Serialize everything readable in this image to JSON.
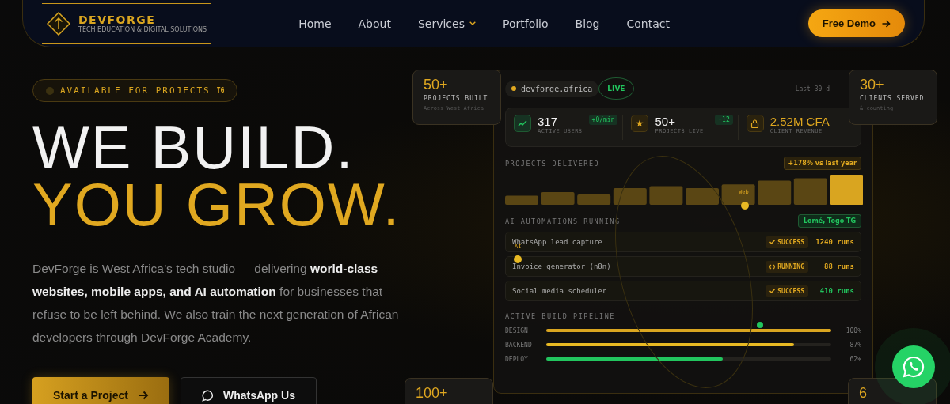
{
  "nav": {
    "logo": {
      "name": "DEVFORGE",
      "tagline": "TECH EDUCATION & DIGITAL SOLUTIONS"
    },
    "links": [
      {
        "label": "Home",
        "dropdown": false
      },
      {
        "label": "About",
        "dropdown": false
      },
      {
        "label": "Services",
        "dropdown": true
      },
      {
        "label": "Portfolio",
        "dropdown": false
      },
      {
        "label": "Blog",
        "dropdown": false
      },
      {
        "label": "Contact",
        "dropdown": false
      }
    ],
    "cta": "Free Demo"
  },
  "hero": {
    "badge": {
      "text": "AVAILABLE FOR PROJECTS",
      "flag": "TG"
    },
    "headline": [
      "WE BUILD.",
      "YOU GROW."
    ],
    "intro": "DevForge is West Africa’s tech studio — delivering **world-class websites, mobile apps, and AI automation** for businesses that refuse to be left behind. We also train the next generation of African developers through DevForge Academy.",
    "buttons": [
      {
        "kind": "primary",
        "label": "Start a Project"
      },
      {
        "kind": "chat",
        "label": "WhatsApp Us"
      }
    ]
  },
  "floating_cards": [
    {
      "value": "50+",
      "label": "PROJECTS BUILT",
      "sub": "Across West Africa"
    },
    {
      "value": "30+",
      "label": "CLIENTS SERVED",
      "sub": "& counting"
    },
    {
      "value": "100+"
    },
    {
      "value": "6"
    }
  ],
  "dashboard": {
    "domain": "devforge.africa",
    "status": "LIVE",
    "period": "Last 30 d",
    "stats": [
      {
        "kind": "trend",
        "value": "317",
        "label": "ACTIVE USERS",
        "delta": "+0/min",
        "accent": false
      },
      {
        "kind": "star",
        "value": "50+",
        "label": "PROJECTS LIVE",
        "delta": "↑12",
        "accent": false
      },
      {
        "kind": "bag",
        "value": "2.52M CFA",
        "label": "CLIENT REVENUE",
        "accent": true
      }
    ],
    "delivered": {
      "title": "PROJECTS DELIVERED",
      "badge": "+178% vs last year"
    },
    "orbit_labels": [
      "Web",
      "AI"
    ],
    "automations": {
      "title": "AI AUTOMATIONS RUNNING",
      "location": "Lomé, Togo",
      "flag": "TG",
      "rows": [
        {
          "name": "WhatsApp lead capture",
          "kind": "success",
          "status": "SUCCESS",
          "runs": "1240 runs",
          "color": "#e0a820"
        },
        {
          "name": "Invoice generator (n8n)",
          "kind": "running",
          "status": "RUNNING",
          "runs": "88 runs",
          "color": "#e0a820"
        },
        {
          "name": "Social media scheduler",
          "kind": "success",
          "status": "SUCCESS",
          "runs": "410 runs",
          "color": "#22c55e"
        }
      ]
    },
    "pipeline": {
      "title": "ACTIVE BUILD PIPELINE",
      "stages": [
        {
          "name": "DESIGN",
          "level": 1,
          "reading": "100%",
          "color": "#d9a520"
        },
        {
          "name": "BACKEND",
          "level": 0.87,
          "reading": "87%",
          "color": "#e8b923"
        },
        {
          "name": "DEPLOY",
          "level": 0.62,
          "reading": "62%",
          "color": "#22c55e"
        }
      ]
    }
  }
}
